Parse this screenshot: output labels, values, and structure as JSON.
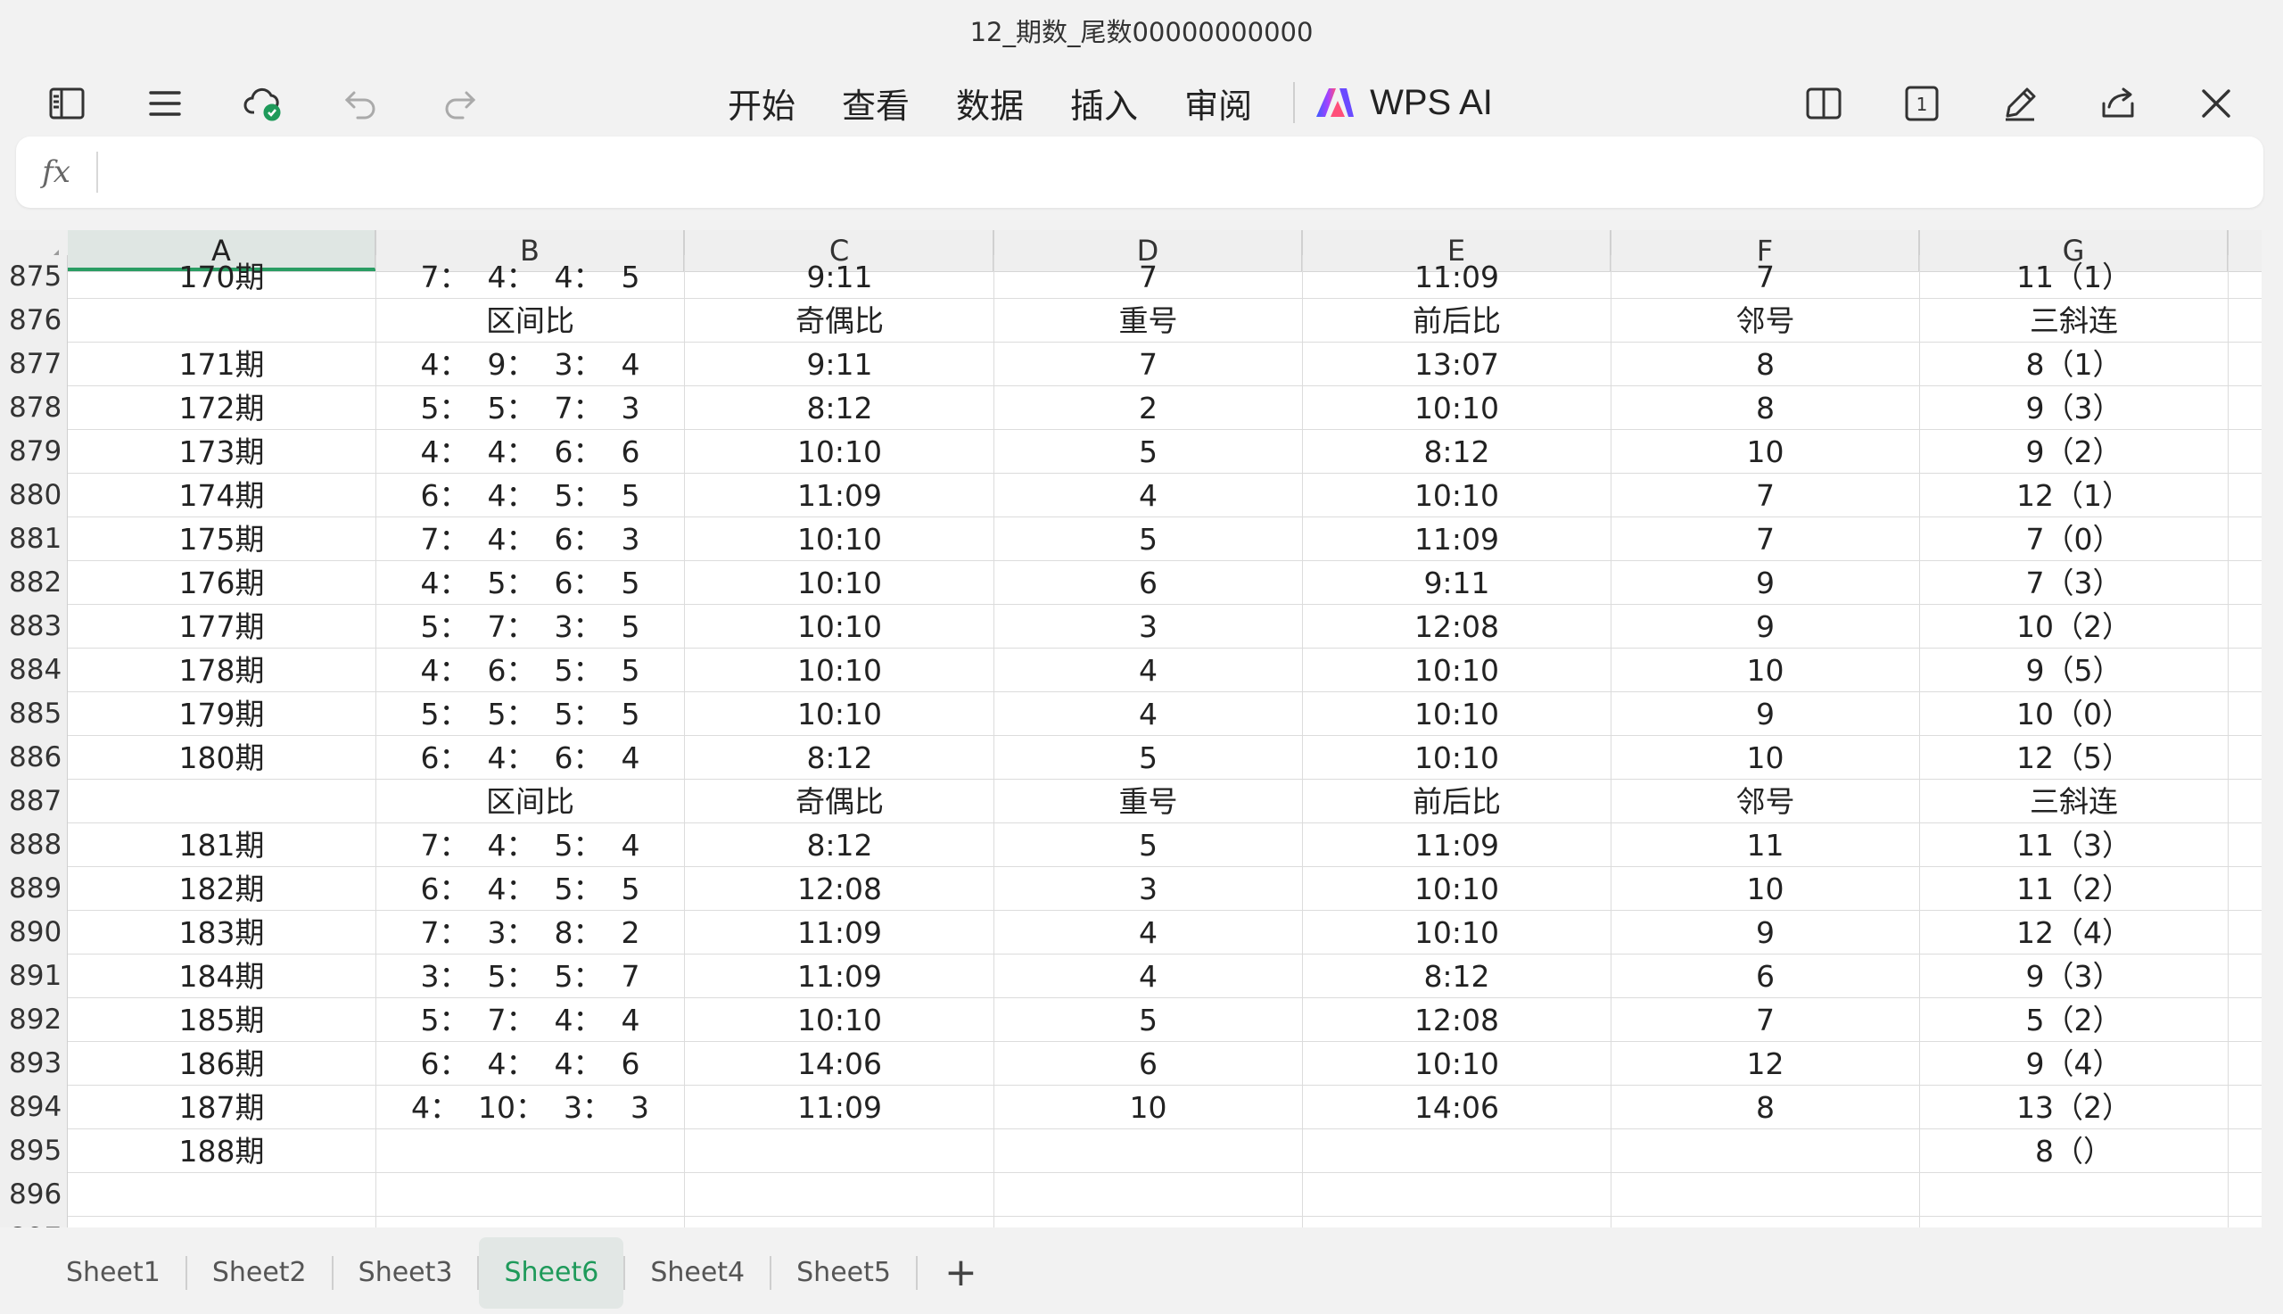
{
  "window": {
    "title": "12_期数_尾数00000000000"
  },
  "toolbar": {
    "left_icons": [
      "sidebar-toggle-icon",
      "menu-icon",
      "cloud-sync-icon",
      "undo-icon",
      "redo-icon"
    ],
    "menu": [
      "开始",
      "查看",
      "数据",
      "插入",
      "审阅"
    ],
    "ai_label": "WPS AI",
    "right_icons": [
      "split-view-icon",
      "page-count-icon",
      "edit-pen-icon",
      "share-icon",
      "close-icon"
    ],
    "page_count": "1"
  },
  "formula_bar": {
    "fx": "fx",
    "value": ""
  },
  "columns": [
    "A",
    "B",
    "C",
    "D",
    "E",
    "F",
    "G"
  ],
  "rows": [
    {
      "n": "875",
      "c": [
        "170期",
        "7：  4：  4：  5",
        "9:11",
        "7",
        "11:09",
        "7",
        "11（1）"
      ]
    },
    {
      "n": "876",
      "c": [
        "",
        "区间比",
        "奇偶比",
        "重号",
        "前后比",
        "邻号",
        "三斜连"
      ]
    },
    {
      "n": "877",
      "c": [
        "171期",
        "4：  9：  3：  4",
        "9:11",
        "7",
        "13:07",
        "8",
        "8（1）"
      ]
    },
    {
      "n": "878",
      "c": [
        "172期",
        "5：  5：  7：  3",
        "8:12",
        "2",
        "10:10",
        "8",
        "9（3）"
      ]
    },
    {
      "n": "879",
      "c": [
        "173期",
        "4：  4：  6：  6",
        "10:10",
        "5",
        "8:12",
        "10",
        "9（2）"
      ]
    },
    {
      "n": "880",
      "c": [
        "174期",
        "6：  4：  5：  5",
        "11:09",
        "4",
        "10:10",
        "7",
        "12（1）"
      ]
    },
    {
      "n": "881",
      "c": [
        "175期",
        "7：  4：  6：  3",
        "10:10",
        "5",
        "11:09",
        "7",
        "7（0）"
      ]
    },
    {
      "n": "882",
      "c": [
        "176期",
        "4：  5：  6：  5",
        "10:10",
        "6",
        "9:11",
        "9",
        "7（3）"
      ]
    },
    {
      "n": "883",
      "c": [
        "177期",
        "5：  7：  3：  5",
        "10:10",
        "3",
        "12:08",
        "9",
        "10（2）"
      ]
    },
    {
      "n": "884",
      "c": [
        "178期",
        "4：  6：  5：  5",
        "10:10",
        "4",
        "10:10",
        "10",
        "9（5）"
      ]
    },
    {
      "n": "885",
      "c": [
        "179期",
        "5：  5：  5：  5",
        "10:10",
        "4",
        "10:10",
        "9",
        "10（0）"
      ]
    },
    {
      "n": "886",
      "c": [
        "180期",
        "6：  4：  6：  4",
        "8:12",
        "5",
        "10:10",
        "10",
        "12（5）"
      ]
    },
    {
      "n": "887",
      "c": [
        "",
        "区间比",
        "奇偶比",
        "重号",
        "前后比",
        "邻号",
        "三斜连"
      ]
    },
    {
      "n": "888",
      "c": [
        "181期",
        "7：  4：  5：  4",
        "8:12",
        "5",
        "11:09",
        "11",
        "11（3）"
      ]
    },
    {
      "n": "889",
      "c": [
        "182期",
        "6：  4：  5：  5",
        "12:08",
        "3",
        "10:10",
        "10",
        "11（2）"
      ]
    },
    {
      "n": "890",
      "c": [
        "183期",
        "7：  3：  8：  2",
        "11:09",
        "4",
        "10:10",
        "9",
        "12（4）"
      ]
    },
    {
      "n": "891",
      "c": [
        "184期",
        "3：  5：  5：  7",
        "11:09",
        "4",
        "8:12",
        "6",
        "9（3）"
      ]
    },
    {
      "n": "892",
      "c": [
        "185期",
        "5：  7：  4：  4",
        "10:10",
        "5",
        "12:08",
        "7",
        "5（2）"
      ]
    },
    {
      "n": "893",
      "c": [
        "186期",
        "6：  4：  4：  6",
        "14:06",
        "6",
        "10:10",
        "12",
        "9（4）"
      ]
    },
    {
      "n": "894",
      "c": [
        "187期",
        "4：  10：  3：  3",
        "11:09",
        "10",
        "14:06",
        "8",
        "13（2）"
      ]
    },
    {
      "n": "895",
      "c": [
        "188期",
        "",
        "",
        "",
        "",
        "",
        "8（）"
      ]
    },
    {
      "n": "896",
      "c": [
        "",
        "",
        "",
        "",
        "",
        "",
        ""
      ]
    },
    {
      "n": "897",
      "c": [
        "",
        "",
        "",
        "",
        "",
        "",
        ""
      ]
    }
  ],
  "sheet_tabs": [
    "Sheet1",
    "Sheet2",
    "Sheet3",
    "Sheet6",
    "Sheet4",
    "Sheet5"
  ],
  "active_tab": "Sheet6",
  "add_tab": "+",
  "colors": {
    "accent": "#1e9a5a",
    "header_bg": "#efefef",
    "grid": "#dcdcdc"
  }
}
